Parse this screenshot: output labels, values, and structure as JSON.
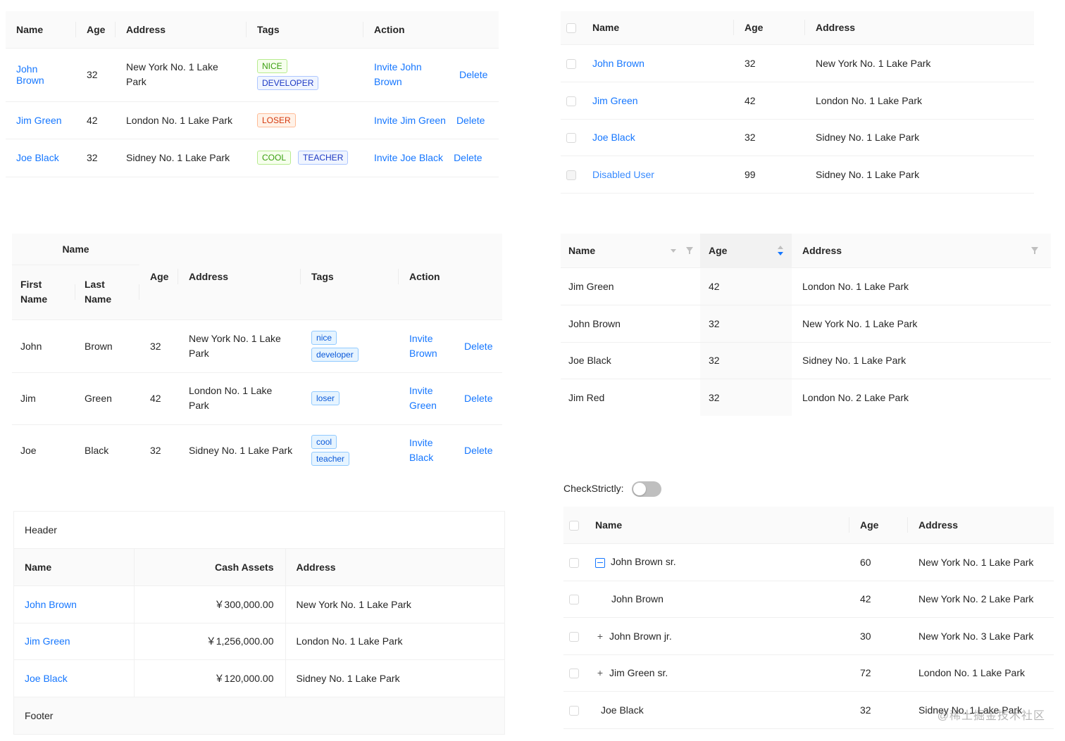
{
  "t1": {
    "headers": {
      "name": "Name",
      "age": "Age",
      "address": "Address",
      "tags": "Tags",
      "action": "Action"
    },
    "rows": [
      {
        "name_l1": "John",
        "name_l2": "Brown",
        "age": "32",
        "addr_l1": "New York No. 1 Lake",
        "addr_l2": "Park",
        "tags": [
          "NICE",
          "DEVELOPER"
        ],
        "invite_l1": "Invite John",
        "invite_l2": "Brown",
        "delete": "Delete"
      },
      {
        "name": "Jim Green",
        "age": "42",
        "address": "London No. 1 Lake Park",
        "tags": [
          "LOSER"
        ],
        "invite": "Invite Jim Green",
        "delete": "Delete"
      },
      {
        "name": "Joe Black",
        "age": "32",
        "address": "Sidney No. 1 Lake Park",
        "tags": [
          "COOL",
          "TEACHER"
        ],
        "invite": "Invite Joe Black",
        "delete": "Delete"
      }
    ]
  },
  "t2": {
    "headers": {
      "name": "Name",
      "age": "Age",
      "address": "Address"
    },
    "rows": [
      {
        "name": "John Brown",
        "age": "32",
        "address": "New York No. 1 Lake Park"
      },
      {
        "name": "Jim Green",
        "age": "42",
        "address": "London No. 1 Lake Park"
      },
      {
        "name": "Joe Black",
        "age": "32",
        "address": "Sidney No. 1 Lake Park"
      },
      {
        "name": "Disabled User",
        "age": "99",
        "address": "Sidney No. 1 Lake Park"
      }
    ]
  },
  "t3": {
    "headers": {
      "name": "Name",
      "first_l1": "First",
      "first_l2": "Name",
      "last_l1": "Last",
      "last_l2": "Name",
      "age": "Age",
      "address": "Address",
      "tags": "Tags",
      "action": "Action"
    },
    "rows": [
      {
        "first": "John",
        "last": "Brown",
        "age": "32",
        "addr_l1": "New York No. 1 Lake",
        "addr_l2": "Park",
        "tags": [
          "nice",
          "developer"
        ],
        "invite_l1": "Invite",
        "invite_l2": "Brown",
        "delete": "Delete"
      },
      {
        "first": "Jim",
        "last": "Green",
        "age": "42",
        "addr_l1": "London No. 1 Lake",
        "addr_l2": "Park",
        "tags": [
          "loser"
        ],
        "invite_l1": "Invite",
        "invite_l2": "Green",
        "delete": "Delete"
      },
      {
        "first": "Joe",
        "last": "Black",
        "age": "32",
        "address": "Sidney No. 1 Lake Park",
        "tags": [
          "cool",
          "teacher"
        ],
        "invite_l1": "Invite",
        "invite_l2": "Black",
        "delete": "Delete"
      }
    ]
  },
  "t4": {
    "headers": {
      "name": "Name",
      "age": "Age",
      "address": "Address"
    },
    "rows": [
      {
        "name": "Jim Green",
        "age": "42",
        "address": "London No. 1 Lake Park"
      },
      {
        "name": "John Brown",
        "age": "32",
        "address": "New York No. 1 Lake Park"
      },
      {
        "name": "Joe Black",
        "age": "32",
        "address": "Sidney No. 1 Lake Park"
      },
      {
        "name": "Jim Red",
        "age": "32",
        "address": "London No. 2 Lake Park"
      }
    ]
  },
  "t5": {
    "title": "Header",
    "footer": "Footer",
    "headers": {
      "name": "Name",
      "cash": "Cash Assets",
      "address": "Address"
    },
    "rows": [
      {
        "name": "John Brown",
        "cash": "￥300,000.00",
        "address": "New York No. 1 Lake Park"
      },
      {
        "name": "Jim Green",
        "cash": "￥1,256,000.00",
        "address": "London No. 1 Lake Park"
      },
      {
        "name": "Joe Black",
        "cash": "￥120,000.00",
        "address": "Sidney No. 1 Lake Park"
      }
    ]
  },
  "t6": {
    "check_label": "CheckStrictly:",
    "headers": {
      "name": "Name",
      "age": "Age",
      "address": "Address"
    },
    "rows": [
      {
        "name": "John Brown sr.",
        "age": "60",
        "address": "New York No. 1 Lake Park"
      },
      {
        "name": "John Brown",
        "age": "42",
        "address": "New York No. 2 Lake Park"
      },
      {
        "name": "John Brown jr.",
        "age": "30",
        "address": "New York No. 3 Lake Park"
      },
      {
        "name": "Jim Green sr.",
        "age": "72",
        "address": "London No. 1 Lake Park"
      },
      {
        "name": "Joe Black",
        "age": "32",
        "address": "Sidney No. 1 Lake Park"
      }
    ]
  },
  "watermark": "@稀土掘金技术社区",
  "colors": {
    "link": "#1677ff",
    "header_bg": "#fafafa",
    "border": "#f0f0f0"
  }
}
